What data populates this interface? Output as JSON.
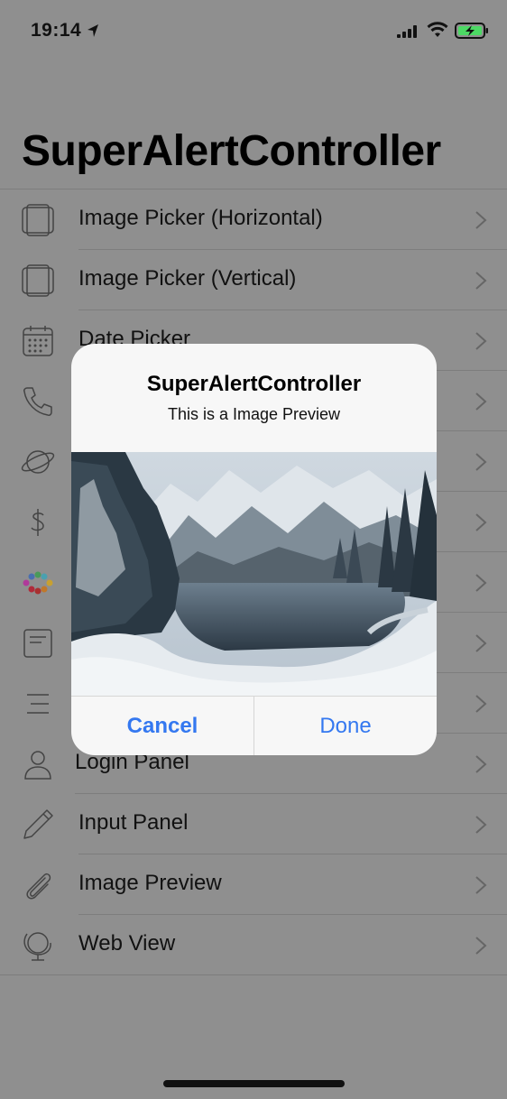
{
  "status_bar": {
    "time": "19:14"
  },
  "nav": {
    "title": "SuperAlertController"
  },
  "list": {
    "items": [
      {
        "label": "Image Picker (Horizontal)",
        "icon": "image-picker-icon"
      },
      {
        "label": "Image Picker (Vertical)",
        "icon": "image-picker-icon"
      },
      {
        "label": "Date Picker",
        "icon": "calendar-icon"
      },
      {
        "label": "",
        "icon": "phone-icon"
      },
      {
        "label": "",
        "icon": "planet-icon"
      },
      {
        "label": "",
        "icon": "dollar-icon"
      },
      {
        "label": "",
        "icon": "color-dots-icon"
      },
      {
        "label": "",
        "icon": "document-icon"
      },
      {
        "label": "",
        "icon": "lines-icon"
      },
      {
        "label": "Login Panel",
        "icon": "person-icon"
      },
      {
        "label": "Input Panel",
        "icon": "pencil-icon"
      },
      {
        "label": "Image Preview",
        "icon": "paperclip-icon"
      },
      {
        "label": "Web View",
        "icon": "globe-icon"
      }
    ]
  },
  "alert": {
    "title": "SuperAlertController",
    "message": "This is a Image Preview",
    "image": "snowy-mountain-lake-photo",
    "cancel_label": "Cancel",
    "done_label": "Done"
  },
  "colors": {
    "overlay": "#8f8f8f",
    "accent": "#3478f0",
    "alert_bg": "#f7f7f7"
  }
}
